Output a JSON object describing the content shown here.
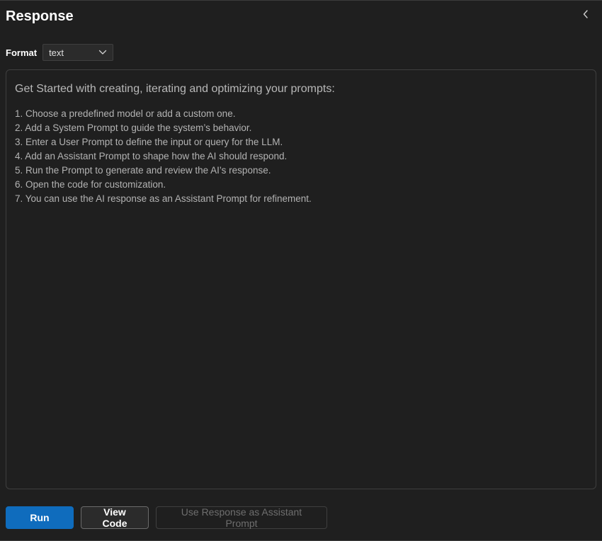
{
  "header": {
    "title": "Response",
    "collapse_icon": "chevron-left-icon"
  },
  "format": {
    "label": "Format",
    "selected": "text",
    "dropdown_icon": "chevron-down-icon"
  },
  "response": {
    "heading": "Get Started with creating, iterating and optimizing your prompts:",
    "steps": [
      "1. Choose a predefined model or add a custom one.",
      "2. Add a System Prompt to guide the system’s behavior.",
      "3. Enter a User Prompt to define the input or query for the LLM.",
      "4. Add an Assistant Prompt to shape how the AI should respond.",
      "5. Run the Prompt to generate and review the AI’s response.",
      "6. Open the code for customization.",
      "7. You can use the AI response as an Assistant Prompt for refinement."
    ]
  },
  "footer": {
    "run_label": "Run",
    "view_code_label": "View Code",
    "use_response_label": "Use Response as Assistant Prompt"
  },
  "colors": {
    "background": "#1f1f1f",
    "primary_button": "#0f6cbd",
    "border": "#3f3f3f"
  }
}
